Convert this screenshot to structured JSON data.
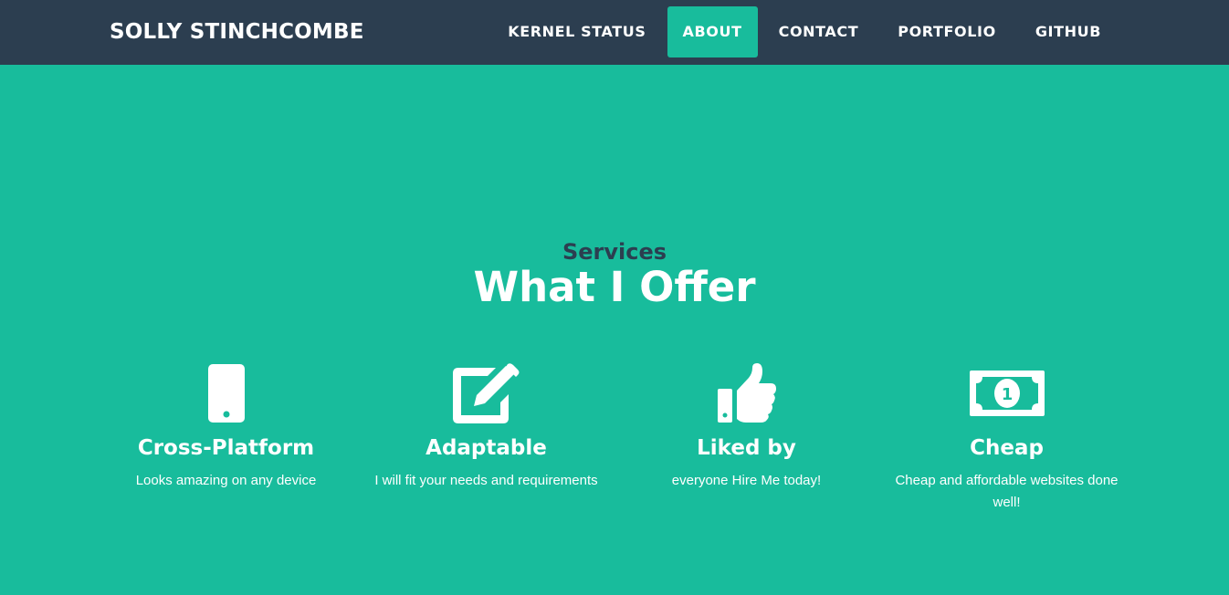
{
  "navbar": {
    "brand": "SOLLY STINCHCOMBE",
    "items": [
      {
        "label": "KERNEL STATUS",
        "active": false
      },
      {
        "label": "ABOUT",
        "active": true
      },
      {
        "label": "CONTACT",
        "active": false
      },
      {
        "label": "PORTFOLIO",
        "active": false
      },
      {
        "label": "GITHUB",
        "active": false
      }
    ]
  },
  "section": {
    "subtitle": "Services",
    "title": "What I Offer"
  },
  "services": [
    {
      "icon": "mobile-icon",
      "title": "Cross-Platform",
      "text": "Looks amazing on any device"
    },
    {
      "icon": "edit-icon",
      "title": "Adaptable",
      "text": "I will fit your needs and requirements"
    },
    {
      "icon": "thumbs-up-icon",
      "title": "Liked by",
      "text": "everyone Hire Me today!"
    },
    {
      "icon": "money-icon",
      "title": "Cheap",
      "text": "Cheap and affordable websites done well!"
    }
  ],
  "colors": {
    "navbar_bg": "#2c3e50",
    "accent": "#18bc9c",
    "text_light": "#ffffff",
    "text_dark": "#2c3e50"
  }
}
